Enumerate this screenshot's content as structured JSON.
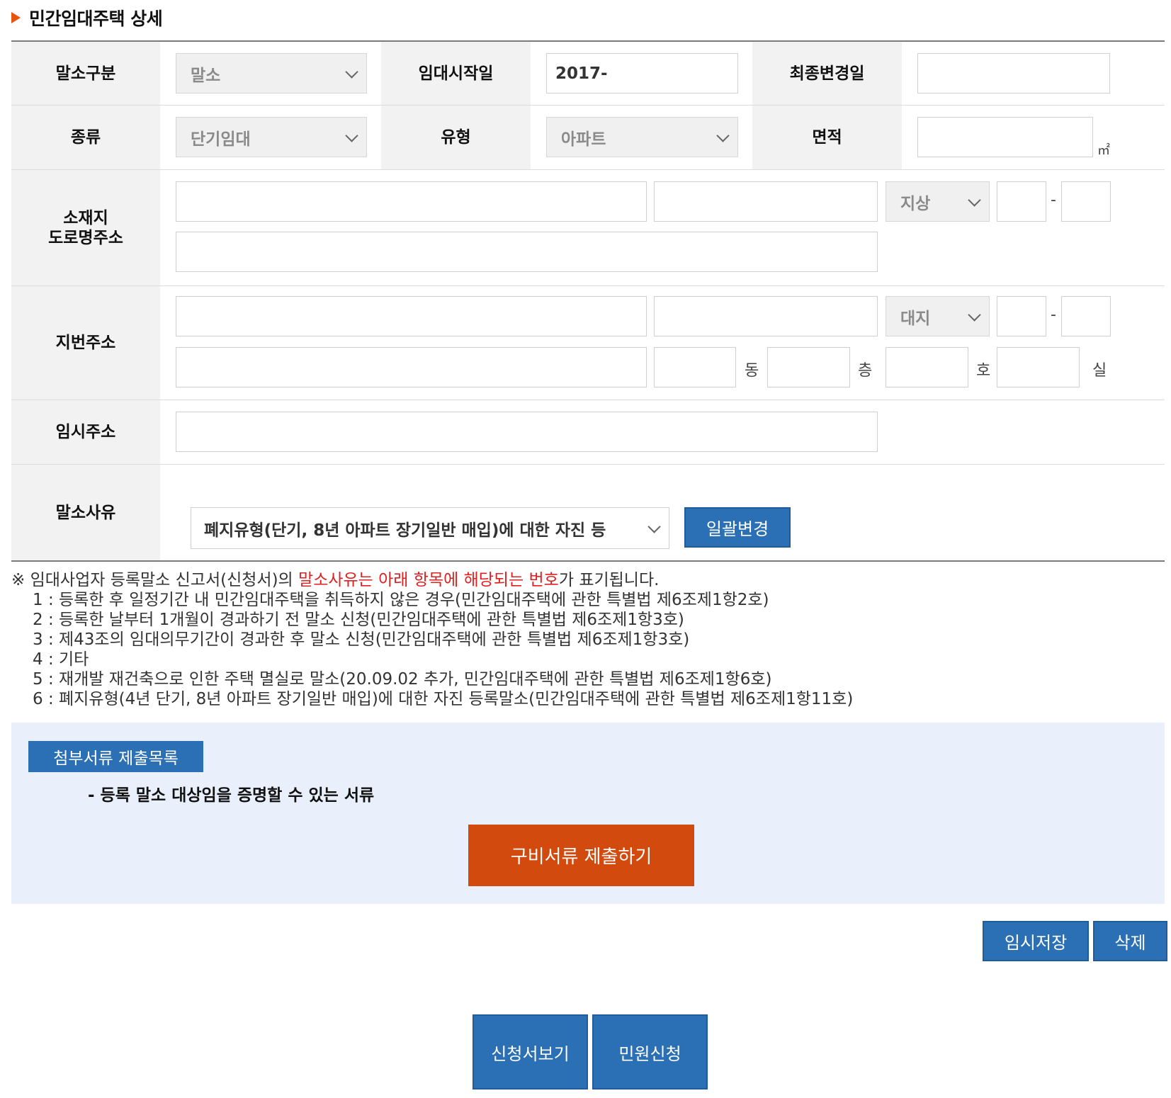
{
  "page_title": "민간임대주택 상세",
  "fields": {
    "cancel_type": {
      "label": "말소구분",
      "value": "말소"
    },
    "rent_start": {
      "label": "임대시작일",
      "value": "2017-"
    },
    "last_changed": {
      "label": "최종변경일",
      "value": ""
    },
    "kind": {
      "label": "종류",
      "value": "단기임대"
    },
    "house_type": {
      "label": "유형",
      "value": "아파트"
    },
    "area": {
      "label": "면적",
      "value": "",
      "unit": "㎡"
    },
    "road_address": {
      "label_line1": "소재지",
      "label_line2": "도로명주소",
      "ground_type": "지상",
      "dash": "-"
    },
    "lot_address": {
      "label": "지번주소",
      "land_type": "대지",
      "dash": "-",
      "unit_dong": "동",
      "unit_floor": "층",
      "unit_ho": "호",
      "unit_room": "실"
    },
    "temp_address": {
      "label": "임시주소",
      "value": ""
    },
    "cancel_reason": {
      "label": "말소사유",
      "value": "폐지유형(단기, 8년 아파트 장기일반 매입)에 대한 자진 등",
      "bulk_change_label": "일괄변경"
    }
  },
  "notes": {
    "intro_before": "※ 임대사업자 등록말소 신고서(신청서)의 ",
    "intro_red": "말소사유는 아래 항목에 해당되는 번호",
    "intro_after": "가 표기됩니다.",
    "items": [
      "1 : 등록한 후 일정기간 내 민간임대주택을 취득하지 않은 경우(민간임대주택에 관한 특별법 제6조제1항2호)",
      "2 : 등록한 날부터 1개월이 경과하기 전 말소 신청(민간임대주택에 관한 특별법 제6조제1항3호)",
      "3 : 제43조의 임대의무기간이 경과한 후 말소 신청(민간임대주택에 관한 특별법 제6조제1항3호)",
      "4 : 기타",
      "5 : 재개발 재건축으로 인한 주택 멸실로 말소(20.09.02 추가, 민간임대주택에 관한 특별법 제6조제1항6호)",
      "6 : 폐지유형(4년 단기, 8년 아파트 장기일반 매입)에 대한 자진 등록말소(민간임대주택에 관한 특별법 제6조제1항11호)"
    ]
  },
  "attachments": {
    "tag": "첨부서류 제출목록",
    "desc": "- 등록 말소 대상임을 증명할 수 있는 서류",
    "submit_label": "구비서류 제출하기"
  },
  "actions": {
    "temp_save": "임시저장",
    "delete": "삭제",
    "view_application": "신청서보기",
    "apply": "민원신청"
  },
  "colors": {
    "accent_orange": "#e8540f",
    "button_blue": "#2b6fb4",
    "submit_red": "#d24a0d",
    "note_red": "#e02020",
    "attach_bg": "#e9f0fb"
  }
}
